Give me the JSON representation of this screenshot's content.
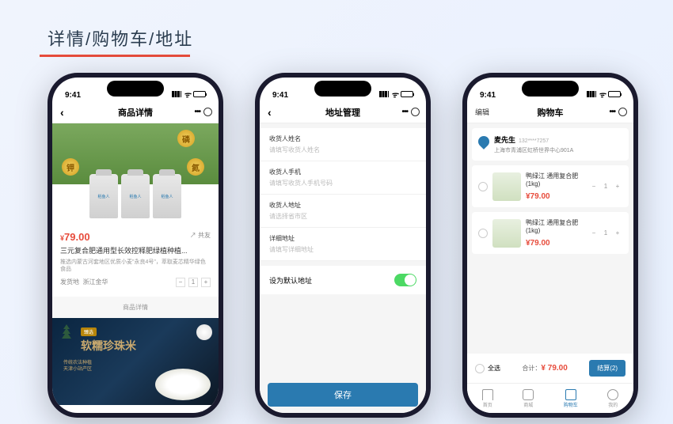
{
  "page_title": "详情/购物车/地址",
  "status_time": "9:41",
  "phone1": {
    "nav_title": "商品详情",
    "elements": [
      "磷",
      "钾",
      "氮"
    ],
    "bottle_brand": "稻鱼人",
    "price": "79.00",
    "currency": "¥",
    "share": "↗ 共友",
    "title": "三元复合肥通用型长效控释肥绿植种植...",
    "desc": "推选内蒙古河套地区优质小麦\"永良4号\"，萃取麦芯精华绿色食品",
    "ship_from": "发货地",
    "ship_loc": "浙江金华",
    "qty": "1",
    "detail_label": "商品详情",
    "banner_title": "软糯珍珠米",
    "banner_tag": "臻选",
    "banner_sub1": "传统农法种植",
    "banner_sub2": "天津小站产区"
  },
  "phone2": {
    "nav_title": "地址管理",
    "fields": [
      {
        "label": "收货人姓名",
        "hint": "请填写收货人姓名"
      },
      {
        "label": "收货人手机",
        "hint": "请填写收货人手机号码"
      },
      {
        "label": "收货人地址",
        "hint": "请选择省市区"
      },
      {
        "label": "详细地址",
        "hint": "请填写详细地址"
      }
    ],
    "default_label": "设为默认地址",
    "save": "保存"
  },
  "phone3": {
    "edit": "编辑",
    "nav_title": "购物车",
    "addr_name": "麦先生",
    "addr_phone": "132****7257",
    "addr_full": "上海市青浦区虹桥世界中心901A",
    "items": [
      {
        "name": "鸭绿江 通用复合肥 (1kg)",
        "price": "¥79.00",
        "qty": "1"
      },
      {
        "name": "鸭绿江 通用复合肥 (1kg)",
        "price": "¥79.00",
        "qty": "1"
      }
    ],
    "select_all": "全选",
    "total_label": "合计：",
    "total_price": "¥ 79.00",
    "checkout": "结算(2)",
    "tabs": [
      "首页",
      "商城",
      "购物车",
      "我的"
    ]
  }
}
